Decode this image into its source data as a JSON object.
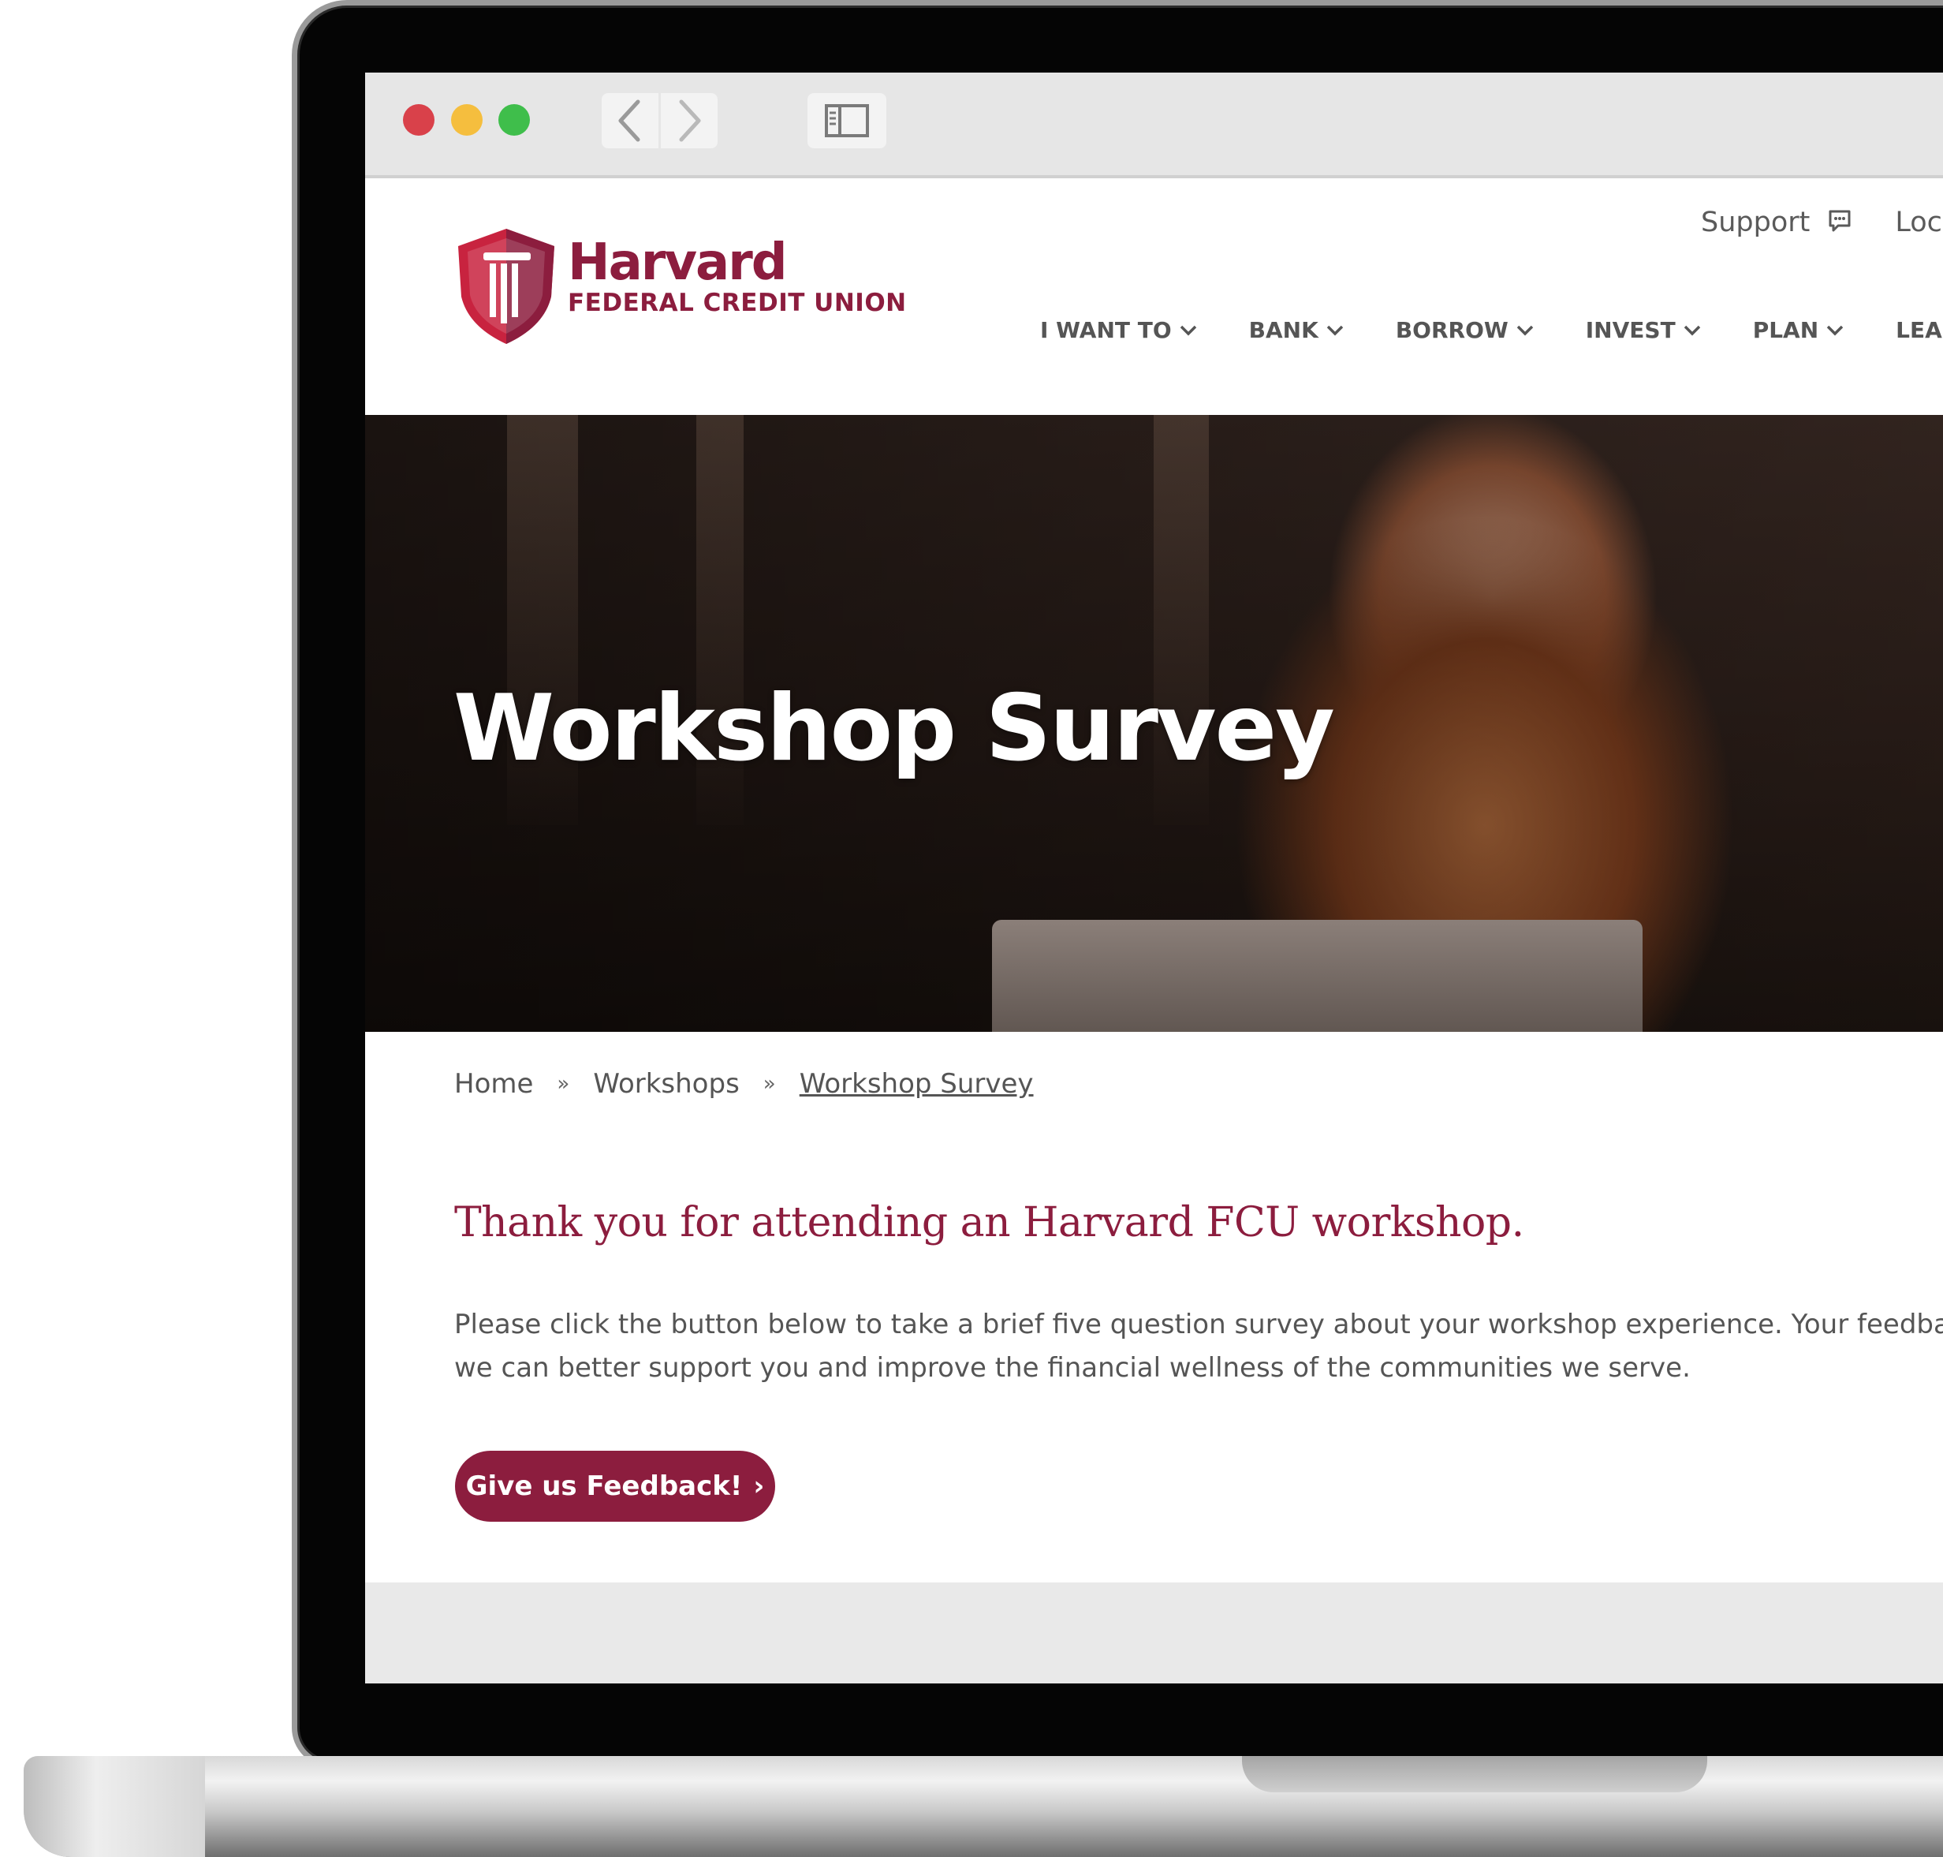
{
  "brand": {
    "name": "Harvard",
    "subtitle": "FEDERAL CREDIT UNION",
    "color": "#8c1d3e"
  },
  "browser": {
    "back_icon": "chevron-left-icon",
    "forward_icon": "chevron-right-icon",
    "sidebar_icon": "sidebar-icon"
  },
  "utility_nav": {
    "support_label": "Support",
    "support_icon": "chat-bubble-icon",
    "locations_label": "Loc"
  },
  "main_nav": {
    "items": [
      {
        "label": "I WANT TO"
      },
      {
        "label": "BANK"
      },
      {
        "label": "BORROW"
      },
      {
        "label": "INVEST"
      },
      {
        "label": "PLAN"
      },
      {
        "label": "LEARN"
      }
    ]
  },
  "hero": {
    "title": "Workshop Survey"
  },
  "breadcrumb": {
    "items": [
      "Home",
      "Workshops",
      "Workshop Survey"
    ],
    "separator": "»"
  },
  "content": {
    "heading": "Thank you for attending an Harvard FCU workshop.",
    "body_line1": "Please click the button below to take a brief five question survey about your workshop experience. Your feedba",
    "body_line2": "we can better support you and improve the financial wellness of the communities we serve.",
    "button_label": "Give us Feedback!",
    "button_arrow": "›"
  }
}
